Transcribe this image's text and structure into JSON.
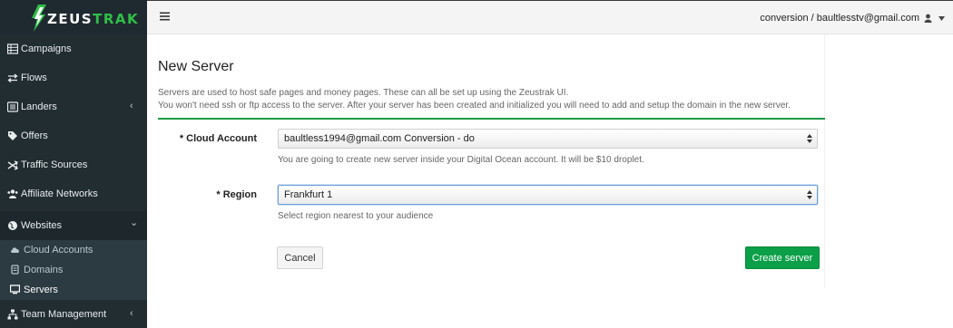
{
  "brand": {
    "name_prefix": "ZEUS",
    "name_suffix": "TRAK"
  },
  "colors": {
    "sidebar_bg": "#222d32",
    "accent_green": "#0a9f48",
    "brand_green": "#2fbf48",
    "header_bg": "#f4f4f4"
  },
  "sidebar": {
    "items": [
      {
        "label": "Campaigns",
        "icon": "table-icon"
      },
      {
        "label": "Flows",
        "icon": "arrows-icon"
      },
      {
        "label": "Landers",
        "icon": "list-icon",
        "chevron": "‹"
      },
      {
        "label": "Offers",
        "icon": "tag-icon"
      },
      {
        "label": "Traffic Sources",
        "icon": "random-icon"
      },
      {
        "label": "Affiliate Networks",
        "icon": "users-icon"
      },
      {
        "label": "Websites",
        "icon": "globe-icon",
        "chevron": "⌄"
      },
      {
        "label": "Team Management",
        "icon": "sitemap-icon",
        "chevron": "‹"
      }
    ],
    "websites_submenu": [
      {
        "label": "Cloud Accounts",
        "icon": "cloud-icon"
      },
      {
        "label": "Domains",
        "icon": "database-icon"
      },
      {
        "label": "Servers",
        "icon": "desktop-icon"
      }
    ]
  },
  "header": {
    "account_text": "conversion / baultlesstv@gmail.com"
  },
  "main": {
    "title": "New Server",
    "description_line1": "Servers are used to host safe pages and money pages. These can all be set up using the Zeustrak UI.",
    "description_line2": "You won't need ssh or ftp access to the server. After your server has been created and initialized you will need to add and setup the domain in the new server.",
    "cloud_account": {
      "label": "* Cloud Account",
      "value": "baultless1994@gmail.com Conversion - do",
      "help": "You are going to create new server inside your Digital Ocean account. It will be $10 droplet."
    },
    "region": {
      "label": "* Region",
      "value": "Frankfurt 1",
      "help": "Select region nearest to your audience"
    },
    "cancel_label": "Cancel",
    "create_label": "Create server"
  }
}
